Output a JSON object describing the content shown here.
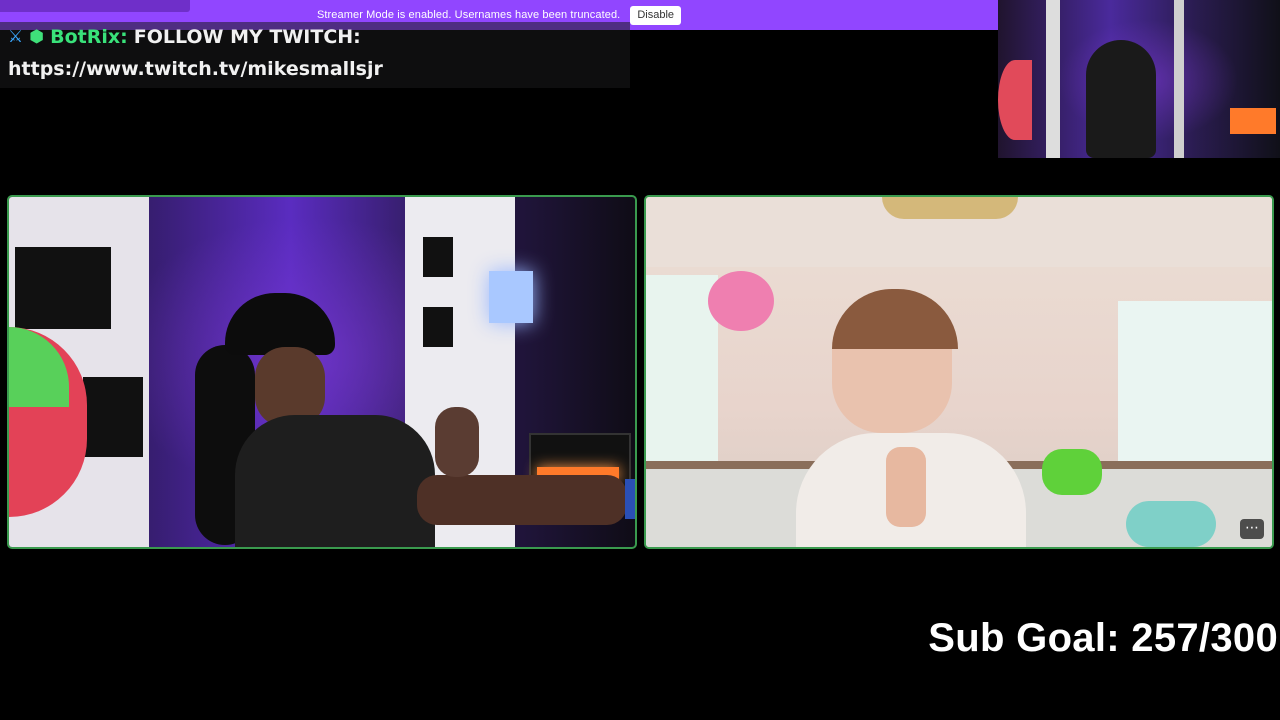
{
  "banner": {
    "text": "Streamer Mode is enabled. Usernames have been truncated.",
    "button_label": "Disable"
  },
  "chat": {
    "username": "BotRix:",
    "message": "FOLLOW MY TWITCH:",
    "link": "https://www.twitch.tv/mikesmallsjr",
    "icons": [
      "sword-icon",
      "bot-icon"
    ]
  },
  "stream": {
    "sub_goal": "Sub Goal: 257/300"
  },
  "colors": {
    "accent": "#9146ff",
    "panel_border": "#3a9a4e",
    "bot_name": "#39e27a"
  }
}
